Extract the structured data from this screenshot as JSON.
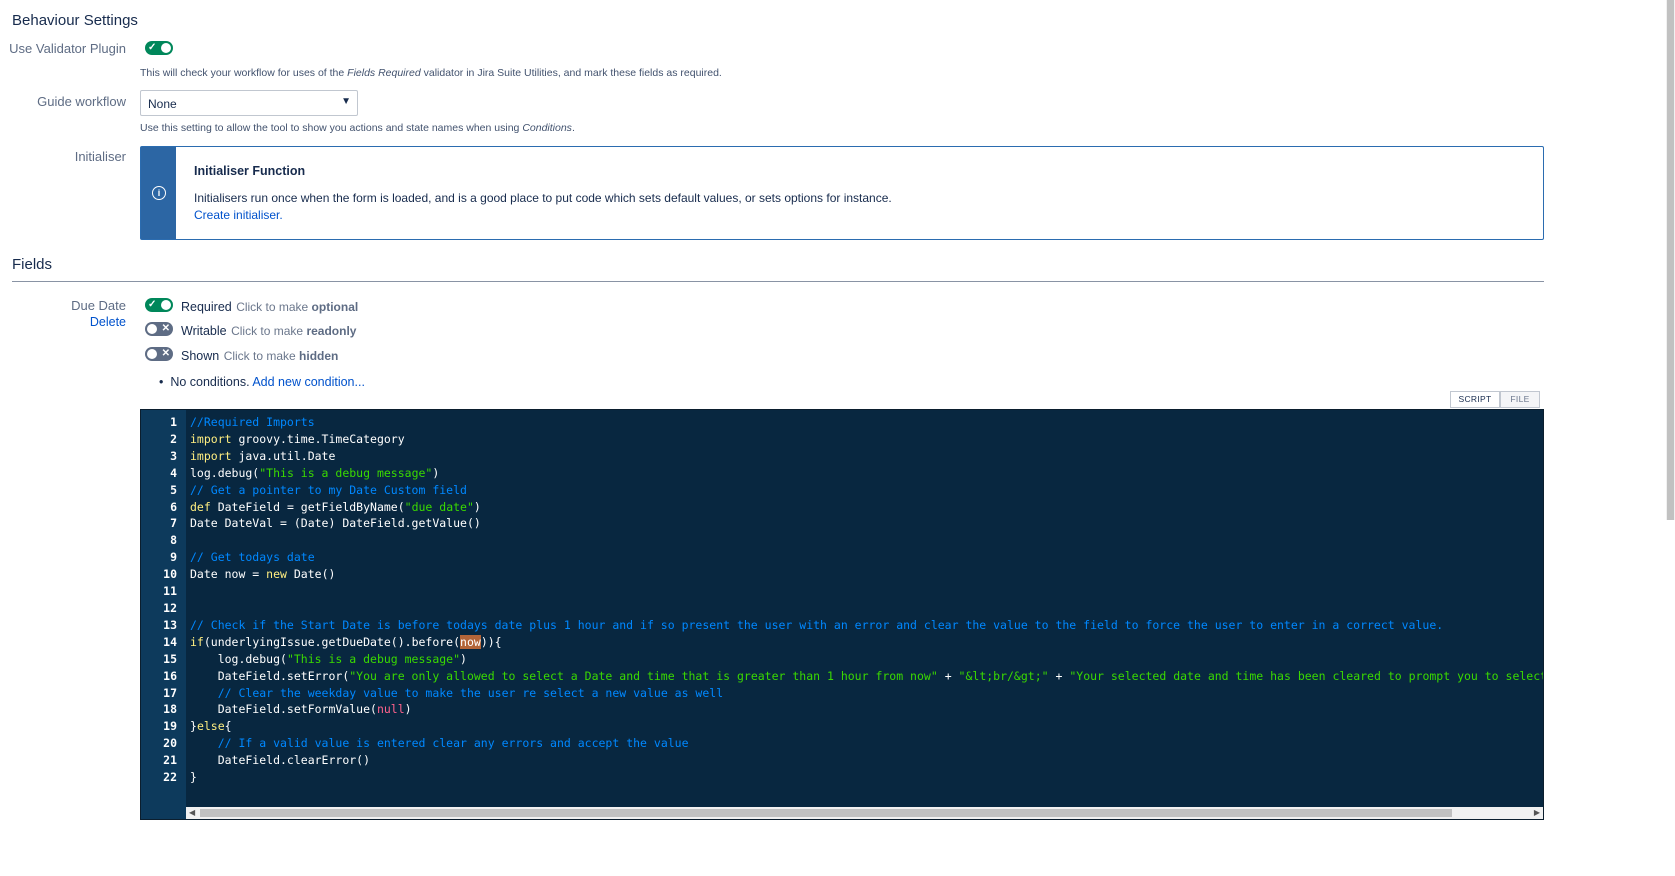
{
  "behaviour": {
    "heading": "Behaviour Settings",
    "validator_label": "Use Validator Plugin",
    "validator_desc_pre": "This will check your workflow for uses of the ",
    "validator_desc_em": "Fields Required",
    "validator_desc_post": " validator in Jira Suite Utilities, and mark these fields as required.",
    "guide_label": "Guide workflow",
    "guide_value": "None",
    "guide_desc_pre": "Use this setting to allow the tool to show you actions and state names when using ",
    "guide_desc_em": "Conditions",
    "guide_desc_post": ".",
    "init_label": "Initialiser",
    "init_title": "Initialiser Function",
    "init_text": "Initialisers run once when the form is loaded, and is a good place to put code which sets default values, or sets options for instance.",
    "init_link": "Create initialiser."
  },
  "fields": {
    "heading": "Fields",
    "field_name": "Due Date",
    "delete_link": "Delete",
    "required_label": "Required",
    "required_hint": "Click to make ",
    "required_hint_b": "optional",
    "writable_label": "Writable",
    "writable_hint": "Click to make ",
    "writable_hint_b": "readonly",
    "shown_label": "Shown",
    "shown_hint": "Click to make ",
    "shown_hint_b": "hidden",
    "no_conditions": "No conditions.",
    "add_condition": "Add new condition...",
    "tab_script": "SCRIPT",
    "tab_file": "FILE"
  },
  "toggles": {
    "validator": "on",
    "required": "on",
    "writable": "off",
    "shown": "off"
  },
  "editor": {
    "line_numbers": [
      "1",
      "2",
      "3",
      "4",
      "5",
      "6",
      "7",
      "8",
      "9",
      "10",
      "11",
      "12",
      "13",
      "14",
      "15",
      "16",
      "17",
      "18",
      "19",
      "20",
      "21",
      "22"
    ]
  },
  "colors": {
    "accent_green": "#00875a",
    "link_blue": "#0052cc",
    "editor_bg": "#082740",
    "gutter_bg": "#0d3a5c",
    "comment": "#0088ff",
    "string": "#3ad900",
    "keyword": "#ffee80"
  },
  "icons": [
    "check-icon",
    "cross-icon",
    "info-icon",
    "dropdown-arrow-icon"
  ]
}
